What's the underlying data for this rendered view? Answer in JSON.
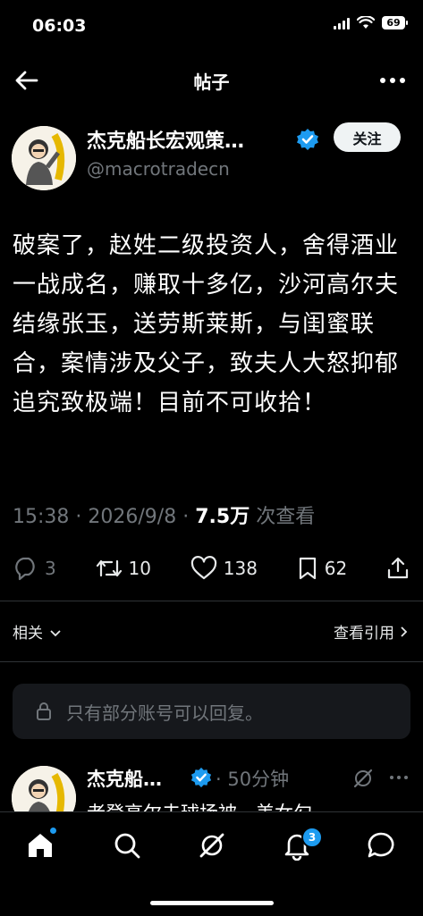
{
  "status": {
    "time": "06:03",
    "battery": "69"
  },
  "header": {
    "title": "帖子"
  },
  "tweet": {
    "author_name": "杰克船长宏观策…",
    "handle": "@macrotradecn",
    "follow_label": "关注",
    "text": "破案了，赵姓二级投资人，舍得酒业一战成名，赚取十多亿，沙河高尔夫结缘张玉，送劳斯莱斯，与闺蜜联合，案情涉及父子，致夫人大怒抑郁追究致极端！目前不可收拾！",
    "time": "15:38",
    "date": "2026/9/8",
    "views": "7.5万",
    "views_label": "次查看",
    "replies": "3",
    "retweets": "10",
    "likes": "138",
    "bookmarks": "62"
  },
  "sections": {
    "related": "相关",
    "view_quotes": "查看引用"
  },
  "reply_restricted": {
    "text": "只有部分账号可以回复。"
  },
  "next_tweet": {
    "author_name": "杰克船…",
    "time": "50分钟",
    "preview": "老登高尔夫球场被一美女勾"
  },
  "nav": {
    "notifications_badge": "3"
  },
  "colors": {
    "accent": "#1d9bf0",
    "muted": "#71767b",
    "background": "#000000"
  }
}
